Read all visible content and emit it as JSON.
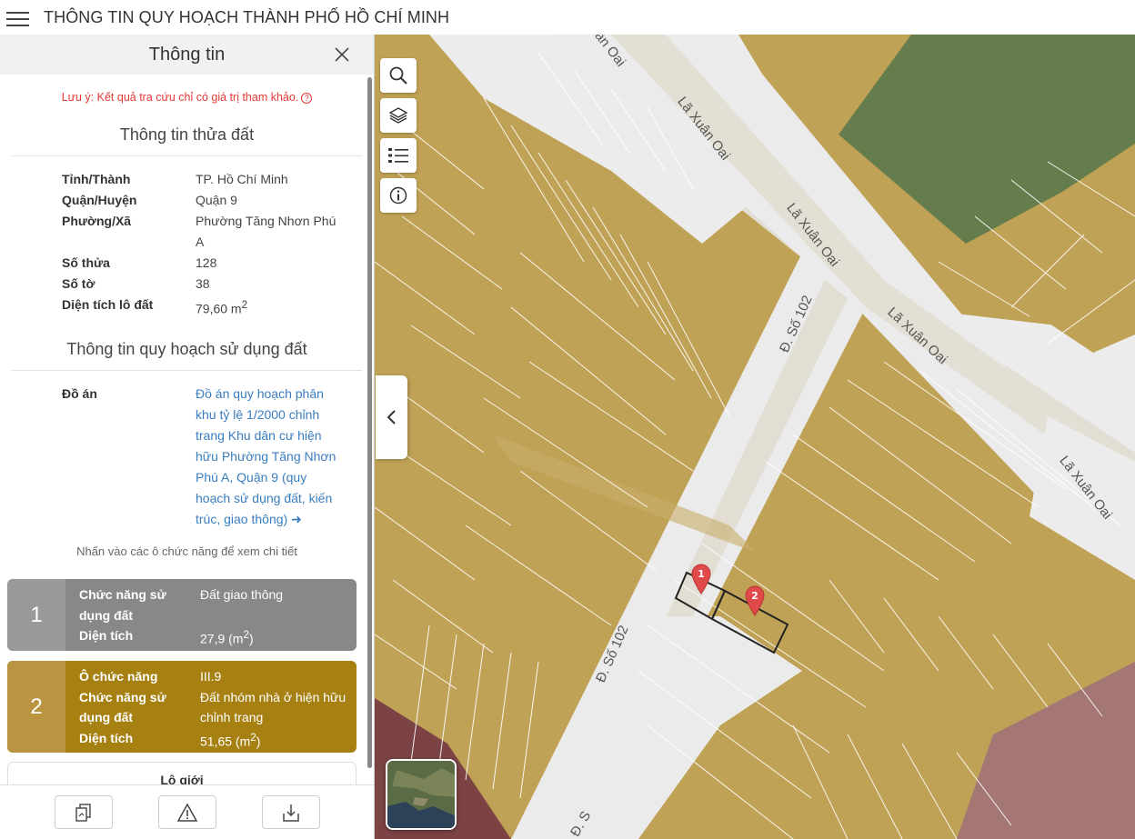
{
  "header": {
    "title": "THÔNG TIN QUY HOẠCH THÀNH PHỐ HỒ CHÍ MINH"
  },
  "panel": {
    "title": "Thông tin",
    "note": "Lưu ý: Kết quả tra cứu chỉ có giá trị tham khảo.",
    "note_icon": "?",
    "parcel_section_title": "Thông tin thửa đất",
    "parcel": [
      {
        "key": "Tỉnh/Thành",
        "value": "TP. Hồ Chí Minh"
      },
      {
        "key": "Quận/Huyện",
        "value": "Quận 9"
      },
      {
        "key": "Phường/Xã",
        "value": "Phường Tăng Nhơn Phú A"
      },
      {
        "key": "Số thửa",
        "value": "128"
      },
      {
        "key": "Số tờ",
        "value": "38"
      },
      {
        "key": "Diện tích lô đất",
        "value": "79,60 m",
        "sup": "2"
      }
    ],
    "planning_section_title": "Thông tin quy hoạch sử dụng đất",
    "project_key": "Đồ án",
    "project_value": "Đồ án quy hoạch phân khu tỷ lệ 1/2000 chỉnh trang Khu dân cư hiện hữu Phường Tăng Nhơn Phú A, Quận 9 (quy hoạch sử dụng đất, kiến trúc, giao thông)",
    "hint": "Nhấn vào các ô chức năng để xem chi tiết",
    "cards": [
      {
        "number": "1",
        "rows": [
          {
            "key": "Chức năng sử dụng đất",
            "value": "Đất giao thông"
          },
          {
            "key": "Diện tích",
            "value": "27,9 (m",
            "sup": "2",
            "tail": ")"
          }
        ]
      },
      {
        "number": "2",
        "rows": [
          {
            "key": "Ô chức năng",
            "value": "III.9"
          },
          {
            "key": "Chức năng sử dụng đất",
            "value": "Đất nhóm nhà ở hiện hữu chỉnh trang"
          },
          {
            "key": "Diện tích",
            "value": "51,65 (m",
            "sup": "2",
            "tail": ")"
          }
        ]
      }
    ],
    "boundary_label": "Lô giới"
  },
  "map": {
    "streets": [
      "Lã Xuân Oai",
      "Lã Xuân Oai",
      "Lã Xuân Oai",
      "Lã Xuân Oai",
      "Lã Xuân Oai",
      "Đ. Số 102",
      "Đ. Số 102",
      "Đ. S"
    ],
    "markers": [
      "1",
      "2"
    ],
    "colors": {
      "residential": "#c0a256",
      "road": "#e4e0d6",
      "pavement": "#ededed",
      "park": "#647c4b",
      "selection": "#222222"
    }
  }
}
